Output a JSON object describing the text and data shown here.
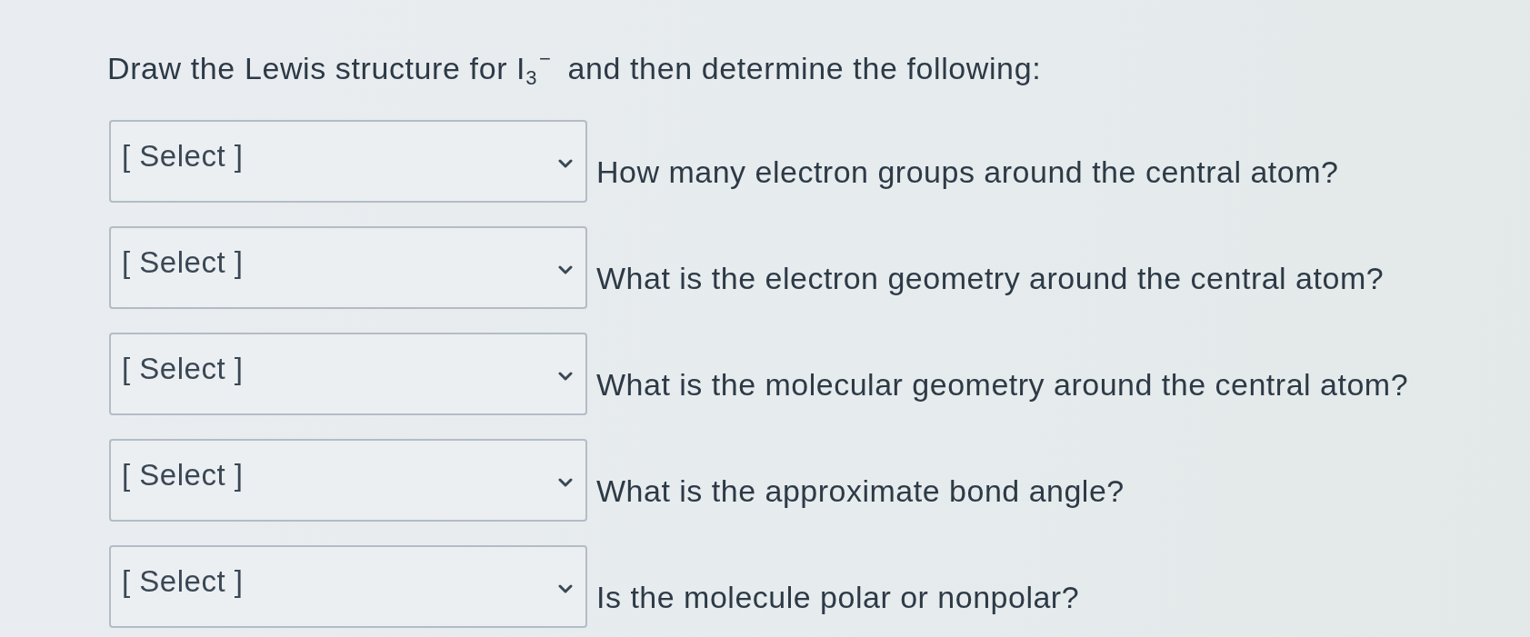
{
  "prompt": "Draw the Lewis structure for I$_{3}$$^{−}$ and then determine the following:",
  "questions": [
    {
      "placeholder": "[ Select ]",
      "label": "How many electron groups around the central atom?"
    },
    {
      "placeholder": "[ Select ]",
      "label": "What is the electron geometry around the central atom?"
    },
    {
      "placeholder": "[ Select ]",
      "label": "What is the molecular geometry around the central atom?"
    },
    {
      "placeholder": "[ Select ]",
      "label": "What is the approximate bond angle?"
    },
    {
      "placeholder": "[ Select ]",
      "label": "Is the molecule polar or nonpolar?"
    }
  ]
}
